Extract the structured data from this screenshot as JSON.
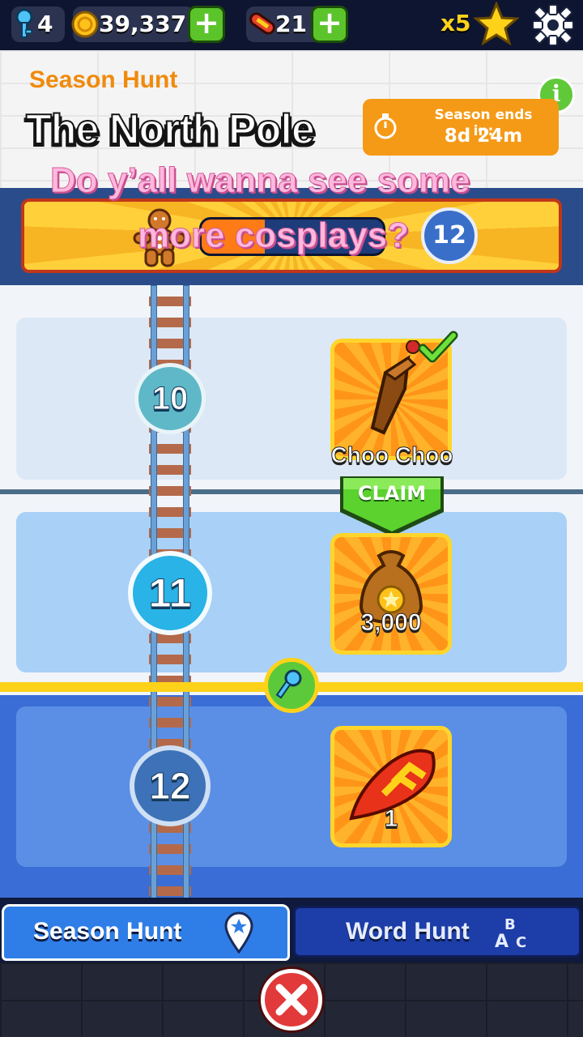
{
  "topbar": {
    "keys": "4",
    "coins": "39,337",
    "hoverboards": "21",
    "multiplier": "x5",
    "icons": [
      "key-icon",
      "coin-icon",
      "hoverboard-icon",
      "star-icon",
      "gear-icon"
    ]
  },
  "header": {
    "section_label": "Season Hunt",
    "title": "The North Pole",
    "timer_label": "Season ends in:",
    "timer_value": "8d 24m"
  },
  "caption": {
    "line1": "Do y’all wanna see some",
    "line2": "more cosplays?"
  },
  "progress": {
    "fill_fraction": 0.35,
    "next_level": "12"
  },
  "levels": [
    {
      "number": "10",
      "reward_name": "Choo Choo",
      "claim_label": "CLAIM",
      "icon": "choo-choo-board-icon",
      "claimed": true
    },
    {
      "number": "11",
      "reward_amount": "3,000",
      "icon": "coin-bag-icon"
    },
    {
      "number": "12",
      "reward_amount": "1",
      "icon": "headstart-icon"
    }
  ],
  "tabs": {
    "season_hunt": "Season Hunt",
    "word_hunt": "Word Hunt"
  },
  "colors": {
    "accent_orange": "#f59a16",
    "claim_green": "#5bc42b",
    "tab_active": "#2f7ee8",
    "close_red": "#e23a3a"
  }
}
